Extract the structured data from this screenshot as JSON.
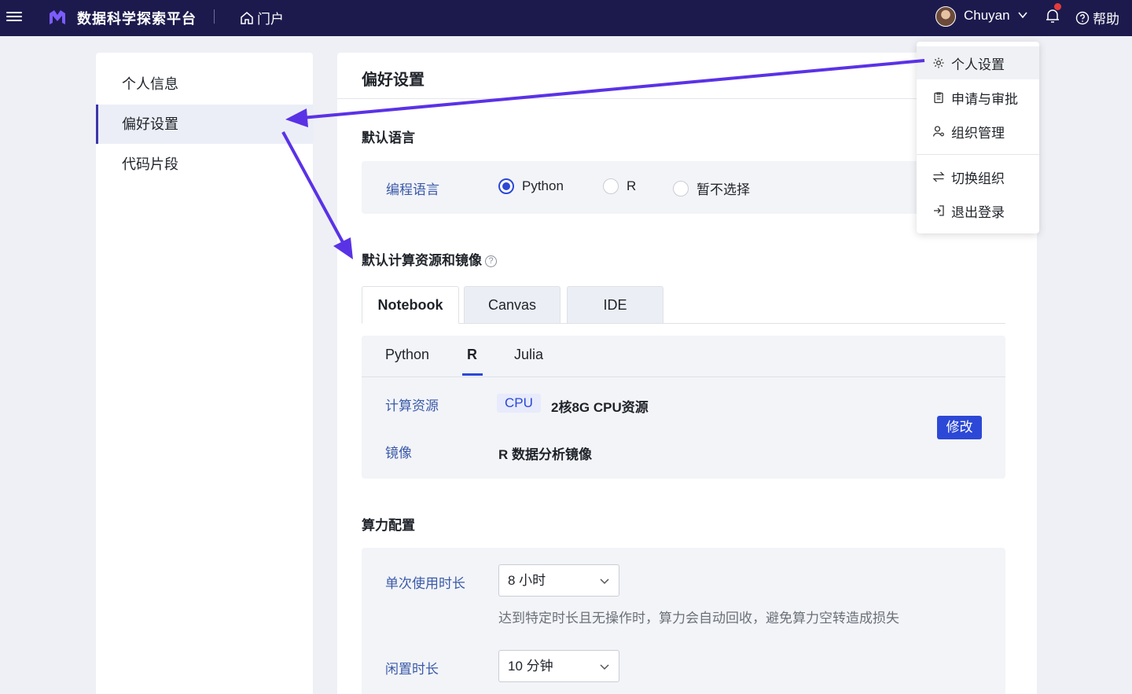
{
  "topbar": {
    "brand": "数据科学探索平台",
    "portal_label": "门户",
    "username": "Chuyan",
    "help_label": "帮助"
  },
  "sidebar": {
    "items": [
      {
        "label": "个人信息"
      },
      {
        "label": "偏好设置"
      },
      {
        "label": "代码片段"
      }
    ]
  },
  "main": {
    "title": "偏好设置",
    "default_language": {
      "heading": "默认语言",
      "field_label": "编程语言",
      "options": [
        "Python",
        "R",
        "暂不选择"
      ],
      "selected": "Python"
    },
    "compute": {
      "heading": "默认计算资源和镜像",
      "help_glyph": "?",
      "tabs": [
        "Notebook",
        "Canvas",
        "IDE"
      ],
      "active_tab": "Notebook",
      "subtabs": [
        "Python",
        "R",
        "Julia"
      ],
      "active_subtab": "R",
      "resource_label": "计算资源",
      "resource_badge": "CPU",
      "resource_value": "2核8G CPU资源",
      "image_label": "镜像",
      "image_value": "R 数据分析镜像",
      "edit_button": "修改"
    },
    "power": {
      "heading": "算力配置",
      "single_use_label": "单次使用时长",
      "single_use_value": "8 小时",
      "single_use_hint": "达到特定时长且无操作时，算力会自动回收，避免算力空转造成损失",
      "idle_label": "闲置时长",
      "idle_value": "10 分钟"
    }
  },
  "user_menu": {
    "items": [
      "个人设置",
      "申请与审批",
      "组织管理",
      "切换组织",
      "退出登录"
    ]
  },
  "colors": {
    "topbar": "#1c1a4d",
    "accent": "#2c48d6",
    "arrow": "#5a32e6"
  }
}
